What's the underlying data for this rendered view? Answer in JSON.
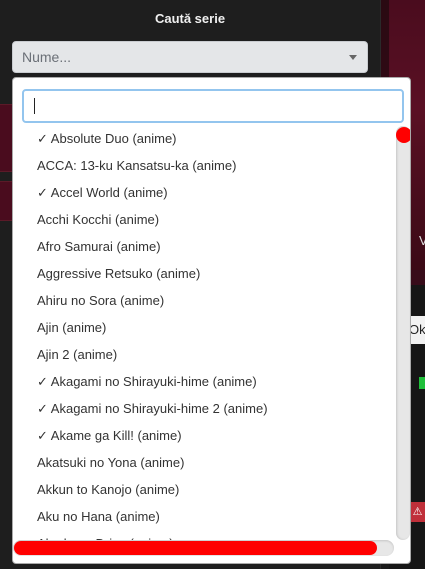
{
  "header": {
    "title": "Caută serie"
  },
  "series_select": {
    "placeholder": "Nume..."
  },
  "dropdown": {
    "search_value": "",
    "items": [
      "✓ Absolute Duo (anime)",
      "ACCA: 13-ku Kansatsu-ka (anime)",
      "✓ Accel World (anime)",
      "Acchi Kocchi (anime)",
      "Afro Samurai (anime)",
      "Aggressive Retsuko (anime)",
      "Ahiru no Sora (anime)",
      "Ajin (anime)",
      "Ajin 2 (anime)",
      "✓ Akagami no Shirayuki-hime (anime)",
      "✓ Akagami no Shirayuki-hime 2 (anime)",
      "✓ Akame ga Kill! (anime)",
      "Akatsuki no Yona (anime)",
      "Akkun to Kanojo (anime)",
      "Aku no Hana (anime)",
      "Akudama Drive (anime)"
    ]
  },
  "background": {
    "partial_text_v": "V",
    "partial_text_ok": "Ok",
    "warn_symbol": "⚠"
  },
  "colors": {
    "scrollbar_thumb": "#ff0000",
    "search_border": "#93c5ee",
    "panel_bg": "#1e1e1e"
  }
}
